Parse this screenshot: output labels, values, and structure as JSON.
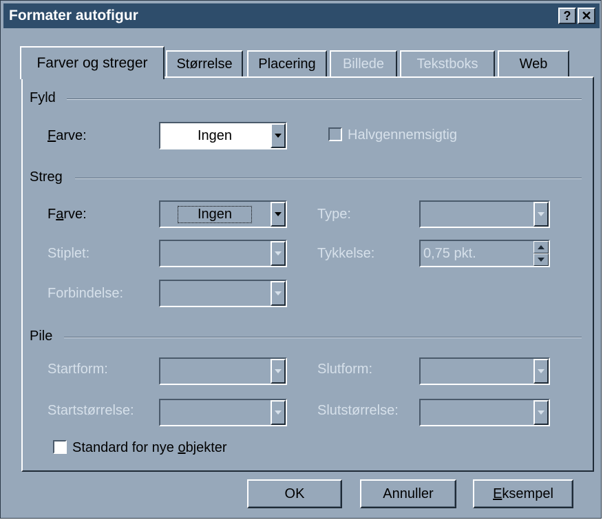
{
  "window": {
    "title": "Formater autofigur",
    "help_btn": "?",
    "close_btn": "✕"
  },
  "tabs": [
    {
      "label": "Farver og streger",
      "active": true,
      "disabled": false
    },
    {
      "label": "Størrelse",
      "active": false,
      "disabled": false
    },
    {
      "label": "Placering",
      "active": false,
      "disabled": false
    },
    {
      "label": "Billede",
      "active": false,
      "disabled": true
    },
    {
      "label": "Tekstboks",
      "active": false,
      "disabled": true
    },
    {
      "label": "Web",
      "active": false,
      "disabled": false
    }
  ],
  "fill": {
    "section_title": "Fyld",
    "color_label_pre": "",
    "color_label_mnemonic": "F",
    "color_label_post": "arve:",
    "color_value": "Ingen",
    "transparent_label": "Halvgennemsigtig"
  },
  "line": {
    "section_title": "Streg",
    "color_label_pre": "F",
    "color_label_mnemonic": "a",
    "color_label_post": "rve:",
    "color_value": "Ingen",
    "type_label": "Type:",
    "dash_label": "Stiplet:",
    "weight_label": "Tykkelse:",
    "weight_value": "0,75 pkt.",
    "connector_label": "Forbindelse:"
  },
  "arrows": {
    "section_title": "Pile",
    "begin_style_label": "Startform:",
    "end_style_label": "Slutform:",
    "begin_size_label": "Startstørrelse:",
    "end_size_label": "Slutstørrelse:"
  },
  "default_checkbox": {
    "label_pre": "Standard for nye ",
    "label_mnemonic": "o",
    "label_post": "bjekter"
  },
  "buttons": {
    "ok": "OK",
    "cancel": "Annuller",
    "preview_mnemonic": "E",
    "preview_rest": "ksempel"
  },
  "colors": {
    "dialog_bg": "#97a8ba",
    "titlebar_bg": "#2e4d6b",
    "disabled_text": "#d6e0ea"
  }
}
